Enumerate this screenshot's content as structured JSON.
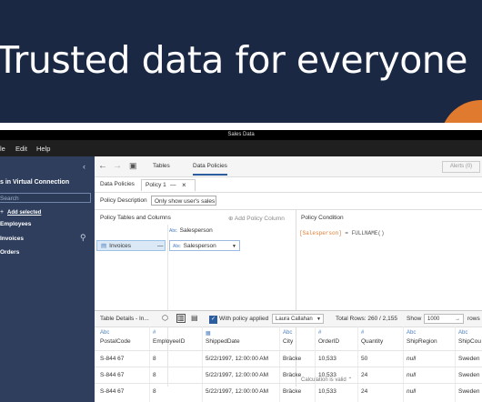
{
  "hero": {
    "title": "Trusted data for everyone"
  },
  "app": {
    "window_title": "Sales Data",
    "menu": [
      "le",
      "Edit",
      "Help"
    ],
    "sidebar": {
      "title": "s in Virtual Connection",
      "search_placeholder": "Search",
      "add_selected": "Add selected",
      "items": [
        "Employees",
        "Invoices",
        "Orders"
      ]
    },
    "toolbar": {
      "tab_tables": "Tables",
      "tab_policies": "Data Policies",
      "right_button": "Alerts (0)"
    },
    "policy_tabs": {
      "data_policies": "Data Policies",
      "policy1": "Policy 1",
      "dash": "—"
    },
    "description": {
      "label": "Policy Description",
      "value": "Only show user's sales"
    },
    "tables_columns": {
      "header": "Policy Tables and Columns",
      "add_column": "Add Policy Column",
      "table": "Invoices",
      "field_top": "Salesperson",
      "field_selected": "Salesperson"
    },
    "condition": {
      "header": "Policy Condition",
      "expr_field": "[Salesperson]",
      "expr_op": "= FULLNAME()",
      "valid": "Calculation is valid"
    },
    "details": {
      "title": "Table Details - In...",
      "with_policy": "With policy applied",
      "user": "Laura Callahan",
      "total_rows": "Total Rows: 260 / 2,155",
      "show_label": "Show",
      "show_value": "1000",
      "rows_label": "rows"
    },
    "table": {
      "columns": [
        {
          "type": "Abc",
          "name": "PostalCode"
        },
        {
          "type": "#",
          "name": "EmployeeID"
        },
        {
          "type": "▦",
          "name": "ShippedDate"
        },
        {
          "type": "Abc",
          "name": "City"
        },
        {
          "type": "#",
          "name": "OrderID"
        },
        {
          "type": "#",
          "name": "Quantity"
        },
        {
          "type": "Abc",
          "name": "ShipRegion"
        },
        {
          "type": "Abc",
          "name": "ShipCou"
        }
      ],
      "rows": [
        [
          "S-844 67",
          "8",
          "5/22/1997, 12:00:00 AM",
          "Bräcke",
          "10,533",
          "50",
          "null",
          "Sweden"
        ],
        [
          "S-844 67",
          "8",
          "5/22/1997, 12:00:00 AM",
          "Bräcke",
          "10,533",
          "24",
          "null",
          "Sweden"
        ],
        [
          "S-844 67",
          "8",
          "5/22/1997, 12:00:00 AM",
          "Bräcke",
          "10,533",
          "24",
          "null",
          "Sweden"
        ]
      ]
    }
  }
}
